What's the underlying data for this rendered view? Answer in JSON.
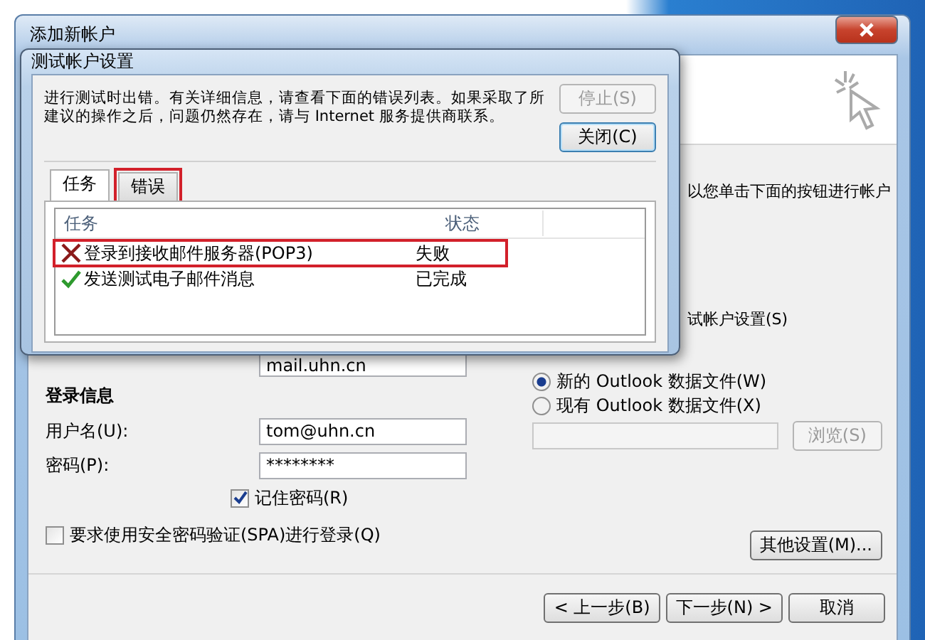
{
  "window": {
    "title": "添加新帐户"
  },
  "intro_text": "以您单击下面的按钮进行帐户",
  "test_settings_text": "试帐户设置(S)",
  "server_field": {
    "value": "mail.uhn.cn"
  },
  "login": {
    "heading": "登录信息",
    "fields": [
      {
        "label": "用户名(U):",
        "value": "tom@uhn.cn"
      },
      {
        "label": "密码(P):",
        "value": "********"
      }
    ],
    "remember": {
      "label": "记住密码(R)",
      "checked": true
    },
    "spa": {
      "label": "要求使用安全密码验证(SPA)进行登录(Q)",
      "checked": false
    }
  },
  "data_file": {
    "options": [
      {
        "label": "新的 Outlook 数据文件(W)",
        "selected": true
      },
      {
        "label": "现有 Outlook 数据文件(X)",
        "selected": false
      }
    ],
    "browse": {
      "label": "浏览(S)",
      "disabled": true
    }
  },
  "more_settings": "其他设置(M)...",
  "nav_buttons": [
    "< 上一步(B)",
    "下一步(N) >",
    "取消"
  ],
  "dialog": {
    "title": "测试帐户设置",
    "message": "进行测试时出错。有关详细信息，请查看下面的错误列表。如果采取了所建议的操作之后，问题仍然存在，请与 Internet 服务提供商联系。",
    "buttons": [
      {
        "label": "停止(S)",
        "disabled": true
      },
      {
        "label": "关闭(C)",
        "disabled": false
      }
    ],
    "tabs": [
      {
        "label": "任务",
        "selected": true,
        "highlighted": false
      },
      {
        "label": "错误",
        "selected": false,
        "highlighted": true
      }
    ],
    "columns": [
      "任务",
      "状态"
    ],
    "rows": [
      {
        "task": "登录到接收邮件服务器(POP3)",
        "status": "失败",
        "kind": "failed",
        "highlighted": true
      },
      {
        "task": "发送测试电子邮件消息",
        "status": "已完成",
        "kind": "done",
        "highlighted": false
      }
    ]
  }
}
